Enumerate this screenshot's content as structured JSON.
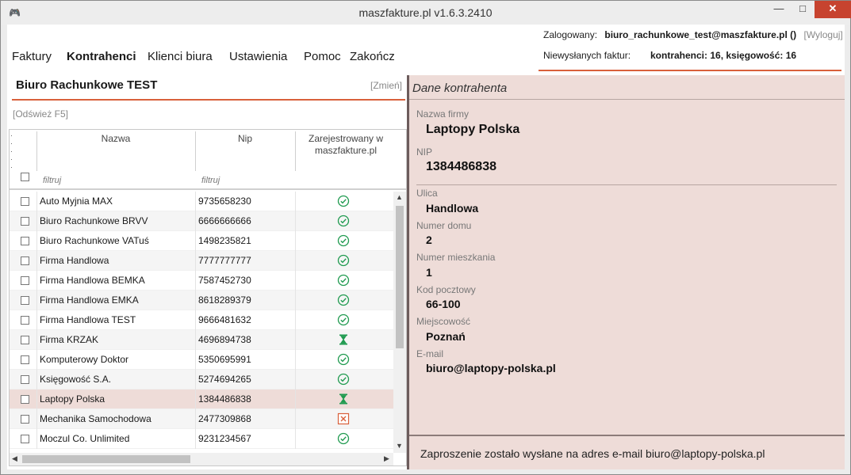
{
  "window": {
    "title": "maszfakture.pl  v1.6.3.2410",
    "minimize": "—",
    "maximize": "□",
    "close": "✕"
  },
  "menu": {
    "items": [
      "Faktury",
      "Kontrahenci",
      "Klienci biura",
      "Ustawienia",
      "Pomoc",
      "Zakończ"
    ],
    "active": "Kontrahenci"
  },
  "login": {
    "label": "Zalogowany:",
    "user": "biuro_rachunkowe_test@maszfakture.pl ()",
    "logout": "[Wyloguj]"
  },
  "unsent": {
    "label": "Niewysłanych faktur:",
    "value": "kontrahenci: 16, księgowość: 16"
  },
  "office": {
    "name": "Biuro Rachunkowe TEST",
    "change": "[Zmień]",
    "refresh": "[Odśwież F5]"
  },
  "grid": {
    "columns": {
      "name": "Nazwa",
      "nip": "Nip",
      "registered": "Zarejestrowany w maszfakture.pl"
    },
    "filter_placeholder": "filtruj",
    "rows": [
      {
        "name": "Auto Myjnia MAX",
        "nip": "9735658230",
        "status": "registered"
      },
      {
        "name": "Biuro Rachunkowe BRVV",
        "nip": "6666666666",
        "status": "registered"
      },
      {
        "name": "Biuro Rachunkowe VATuś",
        "nip": "1498235821",
        "status": "registered"
      },
      {
        "name": "Firma Handlowa",
        "nip": "7777777777",
        "status": "registered"
      },
      {
        "name": "Firma Handlowa BEMKA",
        "nip": "7587452730",
        "status": "registered"
      },
      {
        "name": "Firma Handlowa EMKA",
        "nip": "8618289379",
        "status": "registered"
      },
      {
        "name": "Firma Handlowa TEST",
        "nip": "9666481632",
        "status": "registered"
      },
      {
        "name": "Firma KRZAK",
        "nip": "4696894738",
        "status": "pending"
      },
      {
        "name": "Komputerowy Doktor",
        "nip": "5350695991",
        "status": "registered"
      },
      {
        "name": "Księgowość S.A.",
        "nip": "5274694265",
        "status": "registered"
      },
      {
        "name": "Laptopy Polska",
        "nip": "1384486838",
        "status": "pending",
        "selected": true
      },
      {
        "name": "Mechanika Samochodowa",
        "nip": "2477309868",
        "status": "rejected"
      },
      {
        "name": "Moczul Co. Unlimited",
        "nip": "9231234567",
        "status": "registered"
      }
    ],
    "status_icons": {
      "registered": "check-circle-icon",
      "pending": "hourglass-icon",
      "rejected": "x-box-icon"
    }
  },
  "details": {
    "header": "Dane kontrahenta",
    "company_label": "Nazwa firmy",
    "company": "Laptopy Polska",
    "nip_label": "NIP",
    "nip": "1384486838",
    "street_label": "Ulica",
    "street": "Handlowa",
    "house_label": "Numer domu",
    "house": "2",
    "flat_label": "Numer mieszkania",
    "flat": "1",
    "postal_label": "Kod pocztowy",
    "postal": "66-100",
    "city_label": "Miejscowość",
    "city": "Poznań",
    "email_label": "E-mail",
    "email": "biuro@laptopy-polska.pl"
  },
  "status_bar": {
    "message": "Zaproszenie zostało wysłane na adres e-mail biuro@laptopy-polska.pl"
  },
  "colors": {
    "accent": "#d9603b",
    "ok": "#1f9a4f",
    "error": "#d9603b",
    "selection": "#eedcd8"
  }
}
